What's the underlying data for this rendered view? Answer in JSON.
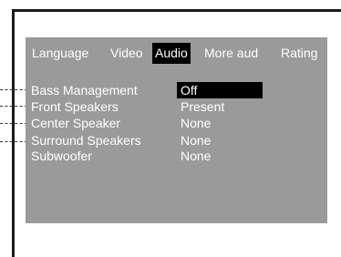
{
  "tabs": [
    {
      "label": "Language",
      "active": false
    },
    {
      "label": "Video",
      "active": false
    },
    {
      "label": "Audio",
      "active": true
    },
    {
      "label": "More aud",
      "active": false
    },
    {
      "label": "Rating",
      "active": false
    }
  ],
  "settings": [
    {
      "label": "Bass Management",
      "value": "Off",
      "selected": true
    },
    {
      "label": "Front Speakers",
      "value": "Present",
      "selected": false
    },
    {
      "label": "Center Speaker",
      "value": "None",
      "selected": false
    },
    {
      "label": "Surround Speakers",
      "value": "None",
      "selected": false
    },
    {
      "label": "Subwoofer",
      "value": "None",
      "selected": false
    }
  ],
  "colors": {
    "screen_bg": "#9a9a9a",
    "highlight": "#000000",
    "text": "#ffffff"
  }
}
